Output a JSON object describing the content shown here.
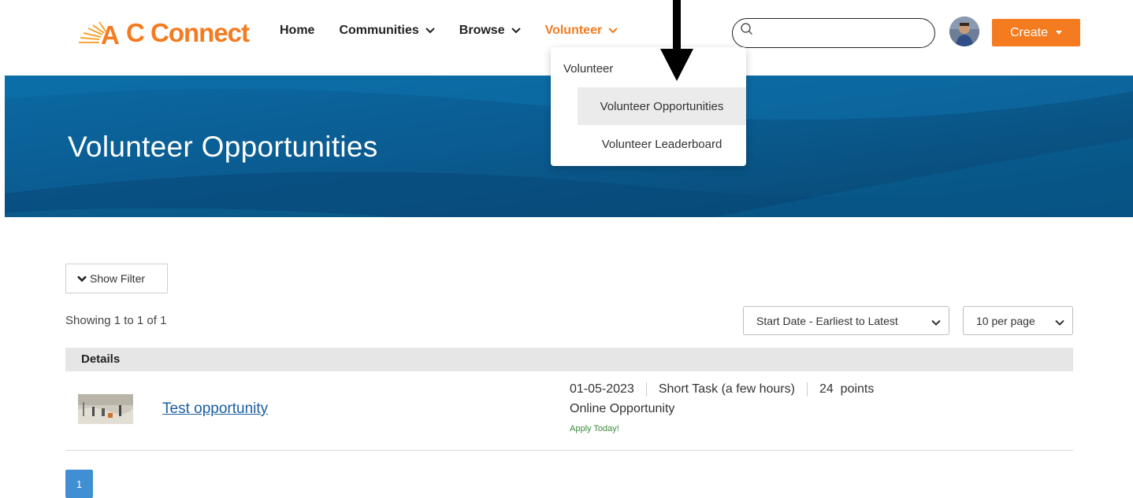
{
  "header": {
    "logo_text": "C Connect",
    "logo_letter": "A",
    "nav": [
      {
        "label": "Home"
      },
      {
        "label": "Communities"
      },
      {
        "label": "Browse"
      },
      {
        "label": "Volunteer"
      }
    ],
    "search": {
      "value": "",
      "placeholder": ""
    },
    "create_label": "Create"
  },
  "dropdown": {
    "header": "Volunteer",
    "items": [
      {
        "label": "Volunteer Opportunities"
      },
      {
        "label": "Volunteer Leaderboard"
      }
    ]
  },
  "banner": {
    "title": "Volunteer Opportunities"
  },
  "filter": {
    "show_filter_label": "Show Filter"
  },
  "results": {
    "showing_text": "Showing 1 to 1 of 1",
    "sort_selected": "Start Date - Earliest to Latest",
    "per_page_selected": "10 per page"
  },
  "table": {
    "header": "Details",
    "rows": [
      {
        "title": "Test opportunity",
        "date": "01-05-2023",
        "duration": "Short Task (a few hours)",
        "points": "24  points",
        "type": "Online Opportunity",
        "cta": "Apply Today!"
      }
    ]
  },
  "pagination": {
    "current": "1"
  },
  "colors": {
    "accent": "#f47b20",
    "banner": "#0a5d93",
    "link": "#1a5ea0",
    "page_active": "#3f8fd2",
    "apply_text": "#3d8a3d"
  },
  "icons": [
    "search-icon",
    "chevron-down-icon",
    "caret-down-icon",
    "down-arrow-annotation-icon"
  ]
}
